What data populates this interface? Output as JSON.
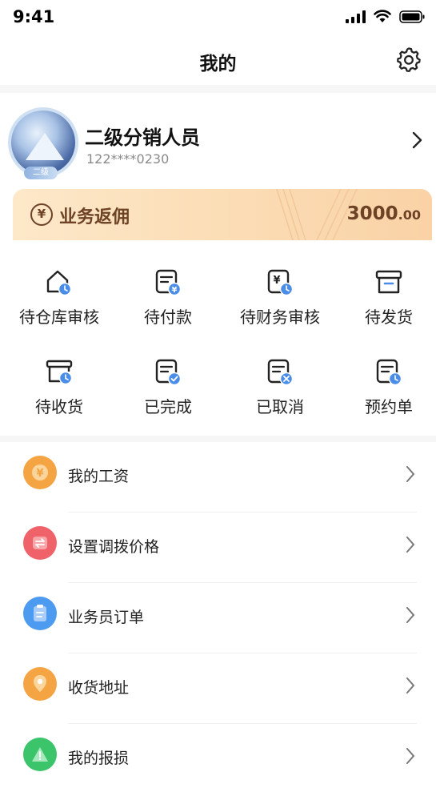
{
  "status_bar": {
    "time": "9:41"
  },
  "nav": {
    "title": "我的"
  },
  "profile": {
    "name": "二级分销人员",
    "phone": "122****0230",
    "avatar_badge": "二级"
  },
  "commission": {
    "icon": "¥",
    "label": "业务返佣",
    "amount_int": "3000",
    "amount_dec": ".00"
  },
  "orders": [
    {
      "label": "待仓库审核",
      "icon": "warehouse-clock-icon"
    },
    {
      "label": "待付款",
      "icon": "bill-yen-icon"
    },
    {
      "label": "待财务审核",
      "icon": "finance-clock-icon"
    },
    {
      "label": "待发货",
      "icon": "box-icon"
    },
    {
      "label": "待收货",
      "icon": "truck-clock-icon"
    },
    {
      "label": "已完成",
      "icon": "bill-check-icon"
    },
    {
      "label": "已取消",
      "icon": "bill-cancel-icon"
    },
    {
      "label": "预约单",
      "icon": "bill-clock-icon"
    }
  ],
  "menu": [
    {
      "label": "我的工资",
      "icon": "yen-icon",
      "color": "#f5a443"
    },
    {
      "label": "设置调拨价格",
      "icon": "swap-icon",
      "color": "#f0626a"
    },
    {
      "label": "业务员订单",
      "icon": "clipboard-icon",
      "color": "#4d9bf0"
    },
    {
      "label": "收货地址",
      "icon": "location-pin-icon",
      "color": "#f5a443"
    },
    {
      "label": "我的报损",
      "icon": "warning-icon",
      "color": "#3cc46b"
    }
  ]
}
